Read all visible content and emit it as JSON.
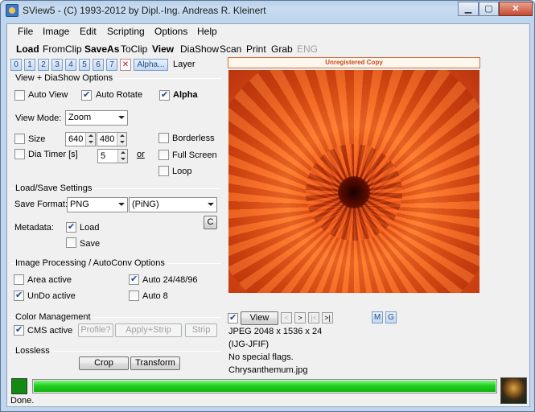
{
  "window": {
    "title": "SView5 - (C) 1993-2012 by Dipl.-Ing. Andreas R. Kleinert",
    "controls": [
      "minimize-icon",
      "maximize-icon",
      "close-icon"
    ]
  },
  "menu": [
    "File",
    "Image",
    "Edit",
    "Scripting",
    "Options",
    "Help"
  ],
  "toolbar": {
    "load": "Load",
    "fromclip": "FromClip",
    "saveas": "SaveAs",
    "toclip": "ToClip",
    "view": "View",
    "diashow": "DiaShow",
    "scan": "Scan",
    "print": "Print",
    "grab": "Grab",
    "eng": "ENG"
  },
  "layers": {
    "buttons": [
      "0",
      "1",
      "2",
      "3",
      "4",
      "5",
      "6",
      "7"
    ],
    "remove_glyph": "✕",
    "alpha_button": "Alpha...",
    "label": "Layer"
  },
  "view_options": {
    "title": "View + DiaShow Options",
    "auto_view": {
      "label": "Auto View",
      "checked": false
    },
    "auto_rotate": {
      "label": "Auto Rotate",
      "checked": true
    },
    "alpha": {
      "label": "Alpha",
      "checked": true
    },
    "view_mode_label": "View Mode:",
    "view_mode_value": "Zoom",
    "size": {
      "label": "Size",
      "checked": false,
      "width": "640",
      "height": "480"
    },
    "borderless": {
      "label": "Borderless",
      "checked": false
    },
    "dia_timer": {
      "label": "Dia Timer [s]",
      "checked": false,
      "value": "5"
    },
    "or_label": "or",
    "full_screen": {
      "label": "Full Screen",
      "checked": false
    },
    "loop": {
      "label": "Loop",
      "checked": false
    }
  },
  "load_save": {
    "title": "Load/Save Settings",
    "save_format_label": "Save Format:",
    "save_format_value": "PNG",
    "save_format_desc": "(PiNG)",
    "c_button": "C",
    "metadata_label": "Metadata:",
    "load": {
      "label": "Load",
      "checked": true
    },
    "save": {
      "label": "Save",
      "checked": false
    }
  },
  "image_processing": {
    "title": "Image Processing / AutoConv Options",
    "area_active": {
      "label": "Area active",
      "checked": false
    },
    "auto_24": {
      "label": "Auto 24/48/96",
      "checked": true
    },
    "undo_active": {
      "label": "UnDo active",
      "checked": true
    },
    "auto_8": {
      "label": "Auto 8",
      "checked": false
    }
  },
  "color_management": {
    "title": "Color Management",
    "cms_active": {
      "label": "CMS active",
      "checked": true
    },
    "profile": "Profile?",
    "apply_strip": "Apply+Strip",
    "strip": "Strip"
  },
  "lossless": {
    "title": "Lossless",
    "crop": "Crop",
    "transform": "Transform"
  },
  "viewer": {
    "banner": "Unregistered Copy",
    "view_checkbox": true,
    "view_button": "View",
    "nav": [
      "<",
      ">",
      "|<",
      ">|"
    ],
    "m_button": "M",
    "g_button": "G",
    "info": [
      "JPEG 2048 x 1536 x 24",
      "(IJG-JFIF)",
      "No special flags.",
      "Chrysanthemum.jpg"
    ]
  },
  "status": {
    "text": "Done.",
    "progress": 1.0
  },
  "colors": {
    "accent": "#1fcf1f",
    "banner": "#c84a1a",
    "status_indicator": "#138a13"
  }
}
